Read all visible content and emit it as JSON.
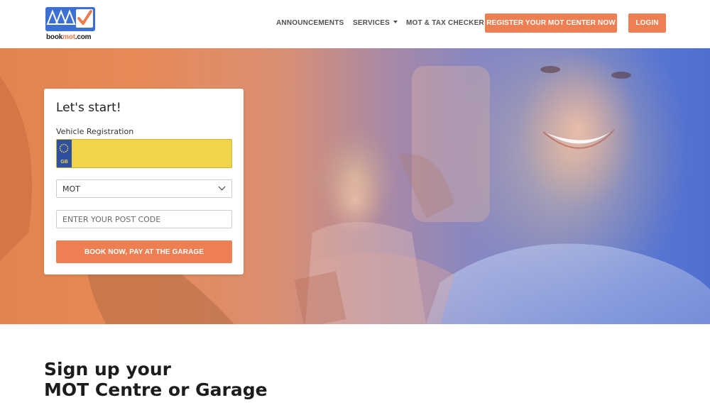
{
  "brand": {
    "logo_text_prefix": "book",
    "logo_text_accent": "mot",
    "logo_text_suffix": ".com"
  },
  "nav": {
    "announcements": "ANNOUNCEMENTS",
    "services": "SERVICES",
    "checker": "MOT & TAX CHECKER",
    "register": "REGISTER YOUR MOT CENTER NOW",
    "login": "LOGIN"
  },
  "form": {
    "title": "Let's start!",
    "vehicle_label": "Vehicle Registration",
    "plate_country": "GB",
    "plate_value": "",
    "service_selected": "MOT",
    "postcode_placeholder": "ENTER YOUR POST CODE",
    "submit": "BOOK NOW, PAY AT THE GARAGE"
  },
  "signup": {
    "line1": "Sign up your",
    "line2": "MOT Centre or Garage"
  },
  "colors": {
    "accent": "#ee7f52",
    "brand_blue": "#3b6fd4",
    "plate_yellow": "#f0d54a",
    "plate_blue": "#2f4fa1"
  }
}
